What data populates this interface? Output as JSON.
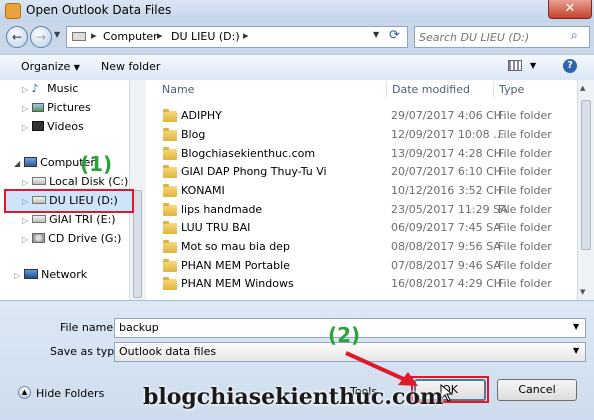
{
  "window": {
    "title": "Open Outlook Data Files",
    "close_glyph": "✕"
  },
  "address": {
    "path": [
      "Computer",
      "DU LIEU (D:)"
    ],
    "search_placeholder": "Search DU LIEU (D:)"
  },
  "toolbar": {
    "organize_label": "Organize",
    "new_folder_label": "New folder"
  },
  "nav": [
    {
      "label": "Music",
      "icon": "music-icon"
    },
    {
      "label": "Pictures",
      "icon": "pictures-icon"
    },
    {
      "label": "Videos",
      "icon": "videos-icon"
    },
    {
      "label": "Computer",
      "icon": "computer-icon"
    },
    {
      "label": "Local Disk (C:)",
      "icon": "drive-icon"
    },
    {
      "label": "DU LIEU (D:)",
      "icon": "drive-icon"
    },
    {
      "label": "GIAI TRI (E:)",
      "icon": "drive-icon"
    },
    {
      "label": "CD Drive (G:)",
      "icon": "cd-drive-icon"
    },
    {
      "label": "Network",
      "icon": "network-icon"
    }
  ],
  "columns": {
    "name": "Name",
    "date": "Date modified",
    "type": "Type"
  },
  "files": [
    {
      "name": "ADIPHY",
      "date": "29/07/2017 4:06 CH",
      "type": "File folder"
    },
    {
      "name": "Blog",
      "date": "12/09/2017 10:08 ...",
      "type": "File folder"
    },
    {
      "name": "Blogchiasekienthuc.com",
      "date": "13/09/2017 4:28 CH",
      "type": "File folder"
    },
    {
      "name": "GIAI DAP Phong Thuy-Tu Vi",
      "date": "20/07/2017 6:10 CH",
      "type": "File folder"
    },
    {
      "name": "KONAMI",
      "date": "10/12/2016 3:52 CH",
      "type": "File folder"
    },
    {
      "name": "lips handmade",
      "date": "23/05/2017 11:29 SA",
      "type": "File folder"
    },
    {
      "name": "LUU TRU BAI",
      "date": "06/09/2017 7:45 SA",
      "type": "File folder"
    },
    {
      "name": "Mot so mau bia dep",
      "date": "08/08/2017 9:56 SA",
      "type": "File folder"
    },
    {
      "name": "PHAN MEM Portable",
      "date": "07/08/2017 9:46 SA",
      "type": "File folder"
    },
    {
      "name": "PHAN MEM Windows",
      "date": "16/08/2017 4:29 CH",
      "type": "File folder"
    }
  ],
  "form": {
    "file_name_label": "File name:",
    "file_name_value": "backup",
    "save_type_label": "Save as type:",
    "save_type_value": "Outlook data files"
  },
  "footer": {
    "hide_folders_label": "Hide Folders",
    "tools_label": "Tools",
    "ok_label": "OK",
    "cancel_label": "Cancel"
  },
  "annotations": {
    "step1": "(1)",
    "step2": "(2)",
    "watermark": "blogchiasekienthuc.com"
  },
  "colors": {
    "highlight": "#e0192a",
    "annotation": "#2ba33d"
  }
}
